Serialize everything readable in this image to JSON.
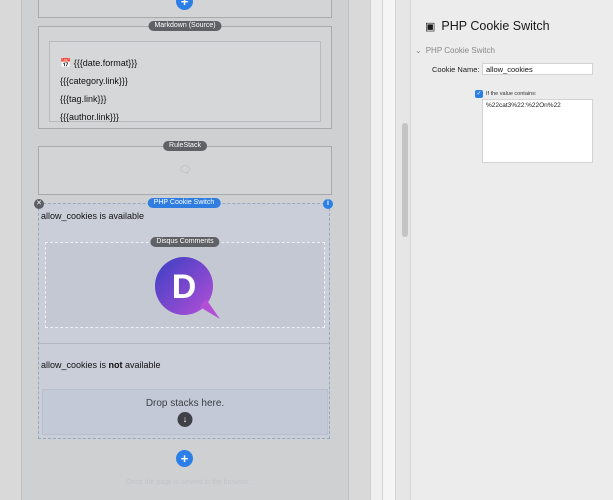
{
  "canvas": {
    "markdown_stack": {
      "label": "Markdown (Source)",
      "lines": [
        "{{{date.format}}}",
        "{{{category.link}}}",
        "{{{tag.link}}}",
        "{{{author.link}}}"
      ]
    },
    "rulestack": {
      "label": "RuleStack"
    },
    "php_cookie_switch": {
      "label": "PHP Cookie Switch",
      "available_text": "allow_cookies is available",
      "not_available_prefix": "allow_cookies is ",
      "not_available_bold": "not",
      "not_available_suffix": " available",
      "disqus_label": "Disqus Comments",
      "disqus_logo_letter": "D",
      "drop_text": "Drop stacks here."
    },
    "add_symbol": "+",
    "footer_text": "Once the page is viewed in the browser..."
  },
  "inspector": {
    "title": "PHP Cookie Switch",
    "section": "PHP Cookie Switch",
    "cookie_name_label": "Cookie Name:",
    "cookie_name_value": "allow_cookies",
    "checkbox_label": "If the value contains:",
    "value_contains": "%22cat3%22:%22On%22"
  },
  "colors": {
    "accent": "#2c7fe6",
    "disqus_gradient_start": "#3a3fc4",
    "disqus_gradient_end": "#b34fd6"
  }
}
